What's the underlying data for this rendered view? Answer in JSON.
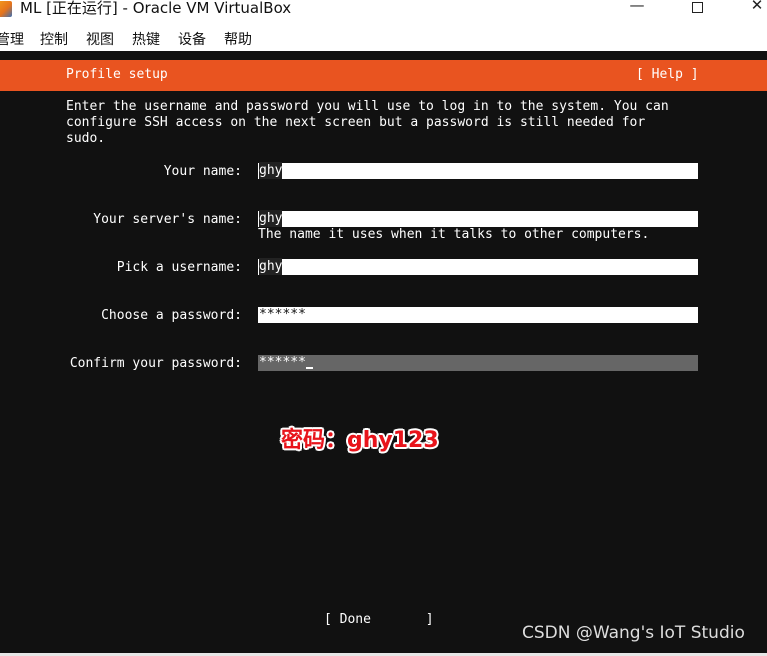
{
  "window": {
    "title": "ML [正在运行] - Oracle VM VirtualBox",
    "minimize_glyph": "—",
    "close_glyph": "✕"
  },
  "menu": {
    "items": [
      "管理",
      "控制",
      "视图",
      "热键",
      "设备",
      "帮助"
    ]
  },
  "installer": {
    "header_title": "Profile setup",
    "help_label": "[ Help ]",
    "intro_lines": [
      "Enter the username and password you will use to log in to the system. You can",
      "configure SSH access on the next screen but a password is still needed for",
      "sudo."
    ],
    "fields": [
      {
        "label": "Your name:",
        "value": "ghy"
      },
      {
        "label": "Your server's name:",
        "value": "ghy",
        "hint": "The name it uses when it talks to other computers."
      },
      {
        "label": "Pick a username:",
        "value": "ghy"
      },
      {
        "label": "Choose a password:",
        "value": "******"
      },
      {
        "label": "Confirm your password:",
        "value": "******"
      }
    ],
    "done_label": "[ Done       ]"
  },
  "annotation": "密码：ghy123",
  "watermark": "CSDN @Wang's IoT Studio",
  "colors": {
    "accent": "#e95420",
    "console_bg": "#111111",
    "annotation": "#e8141b"
  }
}
